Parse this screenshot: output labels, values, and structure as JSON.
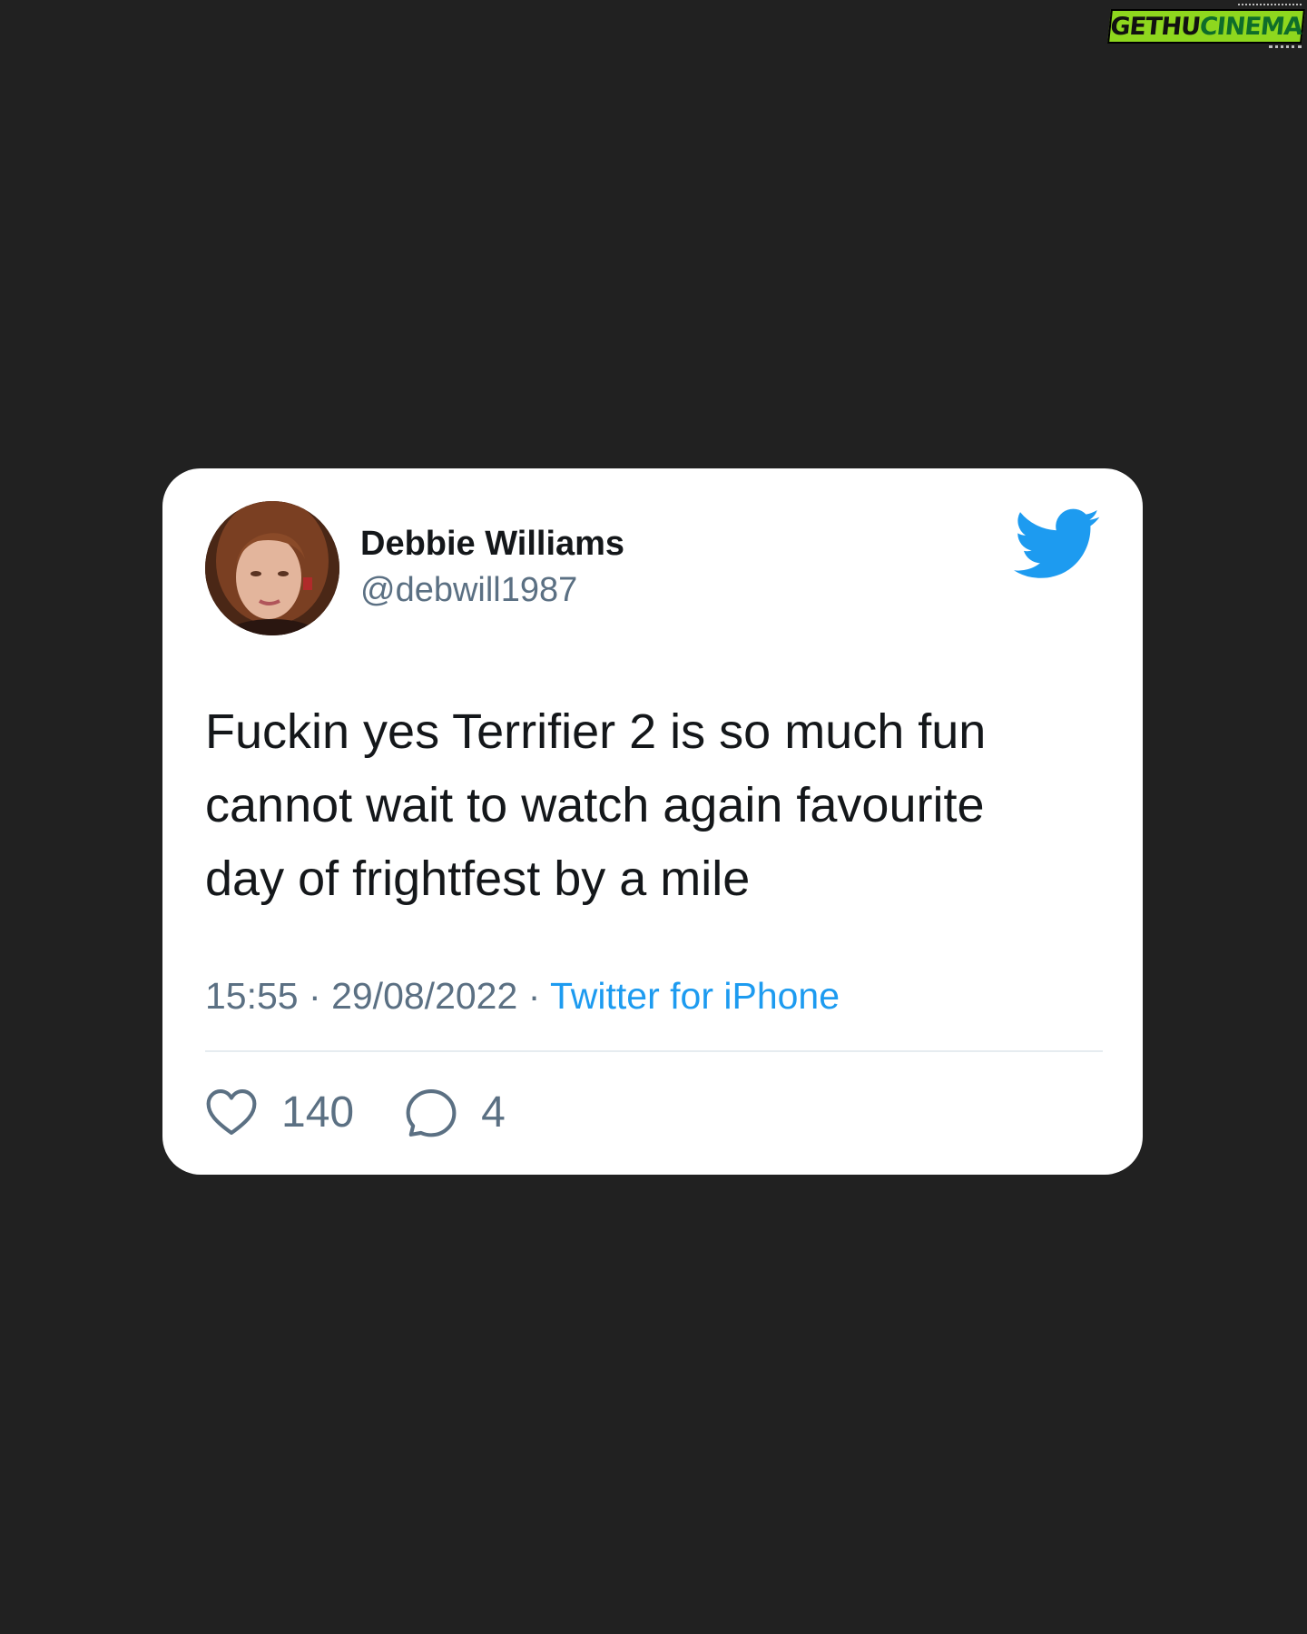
{
  "watermark": {
    "part_a": "GETHU",
    "part_b": "CINEMA"
  },
  "tweet": {
    "user": {
      "name": "Debbie Williams",
      "handle": "@debwill1987"
    },
    "text_lines": [
      "Fuckin yes Terrifier 2 is so much fun",
      "cannot wait to watch again favourite",
      "day of frightfest by a mile"
    ],
    "time": "15:55",
    "separator": "·",
    "date": "29/08/2022",
    "source": "Twitter for iPhone",
    "likes": "140",
    "replies": "4"
  },
  "icons": {
    "brand": "twitter-bird-icon",
    "like": "heart-icon",
    "reply": "speech-bubble-icon"
  },
  "colors": {
    "background": "#212121",
    "card": "#ffffff",
    "twitter_blue": "#1d9bf0",
    "text_primary": "#14171a",
    "text_secondary": "#5b7083",
    "watermark_green": "#8ed71e"
  }
}
